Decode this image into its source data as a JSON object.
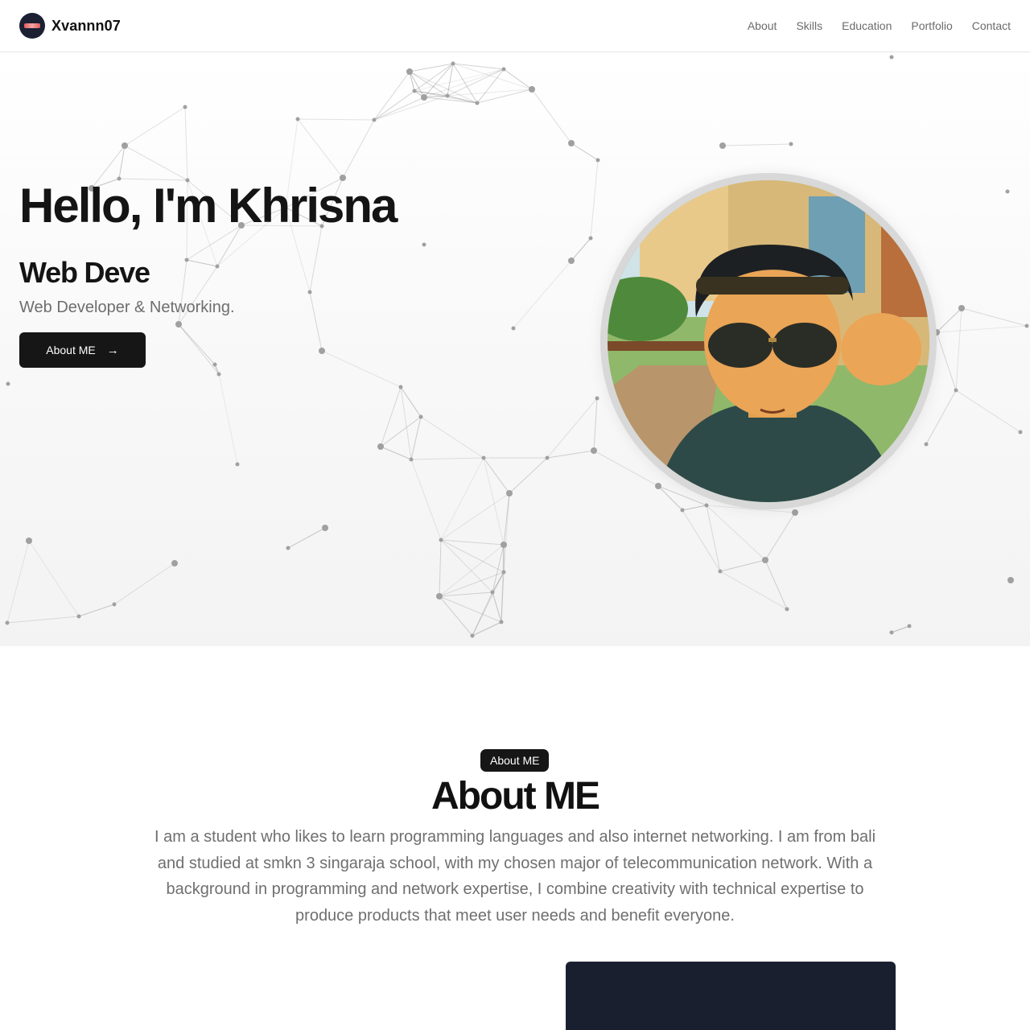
{
  "header": {
    "brand": "Xvannn07",
    "nav": [
      "About",
      "Skills",
      "Education",
      "Portfolio",
      "Contact"
    ]
  },
  "hero": {
    "title": "Hello, I'm Khrisna",
    "typed": "Web Deve",
    "subtitle": "Web Developer & Networking.",
    "button_label": "About ME"
  },
  "about": {
    "badge": "About ME",
    "title": "About ME",
    "text": "I am a student who likes to learn programming languages and also internet networking. I am from bali and studied at smkn 3 singaraja school, with my chosen major of telecommunication network. With a background in programming and network expertise, I combine creativity with technical expertise to produce products that meet user needs and benefit everyone."
  },
  "colors": {
    "button_bg": "#161616",
    "card_bg": "#1a1f30",
    "network_line": "#9a9a9a"
  },
  "icons": [
    "brand-logo-icon",
    "arrow-right-icon",
    "profile-avatar"
  ]
}
